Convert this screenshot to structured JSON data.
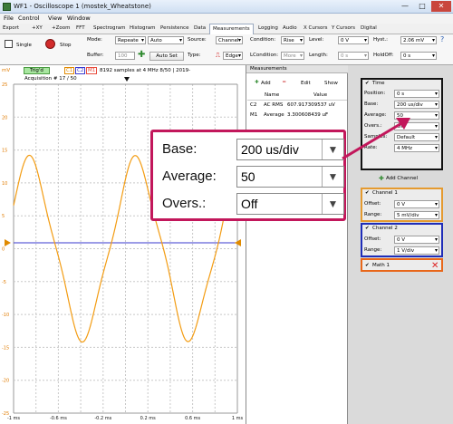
{
  "window": {
    "title": "WF1 - Oscilloscope 1 (mostek_Wheatstone)",
    "min": "—",
    "max": "□",
    "close": "✕"
  },
  "menu": {
    "file": "File",
    "control": "Control",
    "view": "View",
    "window": "Window"
  },
  "tabs": [
    "Export",
    "+XY",
    "+Zoom",
    "FFT",
    "Spectrogram",
    "Histogram",
    "Persistence",
    "Data",
    "Measurements",
    "Logging",
    "Audio",
    "X Cursors",
    "Y Cursors",
    "Digital"
  ],
  "ribbon": {
    "single": "Single",
    "stop": "Stop",
    "mode_label": "Mode:",
    "mode_value": "Repeate",
    "mode_value2": "Auto",
    "buffer_label": "Buffer:",
    "buffer_value": "100",
    "autoset": "Auto Set",
    "source_label": "Source:",
    "source_value": "Channel",
    "type_label": "Type:",
    "type_value": "Edge",
    "condition_label": "Condition:",
    "condition_value": "Rise",
    "lcondition_label": "LCondition:",
    "lcondition_value": "More",
    "level_label": "Level:",
    "level_value": "0 V",
    "length_label": "Length:",
    "length_value": "0 s",
    "hyst_label": "Hyst.:",
    "hyst_value": "2.06 mV",
    "holdoff_label": "HoldOff:",
    "holdoff_value": "0 s"
  },
  "scope": {
    "trig": "Trig'd",
    "c1": "C1",
    "c2": "C2",
    "m1": "M1",
    "samples": "8192 samples at 4 MHz 8/50 | 2019-",
    "acq": "Acquisition # 17 / 50",
    "volt_unit": "mV",
    "yticks": [
      "25",
      "20",
      "15",
      "10",
      "5",
      "0",
      "-5",
      "-10",
      "-15",
      "-20",
      "-25"
    ],
    "xticks": [
      "-1 ms",
      "-0.6 ms",
      "-0.2 ms",
      "0.2 ms",
      "0.6 ms",
      "1 ms"
    ]
  },
  "measurements": {
    "title": "Measurements",
    "add": "Add",
    "edit": "Edit",
    "show": "Show",
    "col_name": "Name",
    "col_value": "Value",
    "rows": [
      {
        "ch": "C2",
        "name": "AC RMS",
        "value": "607.917309537 uV"
      },
      {
        "ch": "M1",
        "name": "Average",
        "value": "3.300608439 uF"
      }
    ]
  },
  "time": {
    "title": "Time",
    "position_label": "Position:",
    "position_value": "0 s",
    "base_label": "Base:",
    "base_value": "200 us/div",
    "average_label": "Average:",
    "average_value": "50",
    "overs_label": "Overs.:",
    "overs_value": "Off",
    "samples_label": "Samples:",
    "samples_value": "Default",
    "rate_label": "Rate:",
    "rate_value": "4 MHz"
  },
  "add_channel": "Add Channel",
  "channel1": {
    "title": "Channel 1",
    "offset_label": "Offset:",
    "offset_value": "0 V",
    "range_label": "Range:",
    "range_value": "5 mV/div"
  },
  "channel2": {
    "title": "Channel 2",
    "offset_label": "Offset:",
    "offset_value": "0 V",
    "range_label": "Range:",
    "range_value": "1 V/div"
  },
  "math1": {
    "title": "Math 1"
  },
  "zoom": {
    "base_label": "Base:",
    "base_value": "200 us/div",
    "average_label": "Average:",
    "average_value": "50",
    "overs_label": "Overs.:",
    "overs_value": "Off"
  },
  "colors": {
    "c1": "#f39c12",
    "c2": "#3a3acf",
    "m1": "#e84c3d",
    "accent": "#c2175b"
  }
}
